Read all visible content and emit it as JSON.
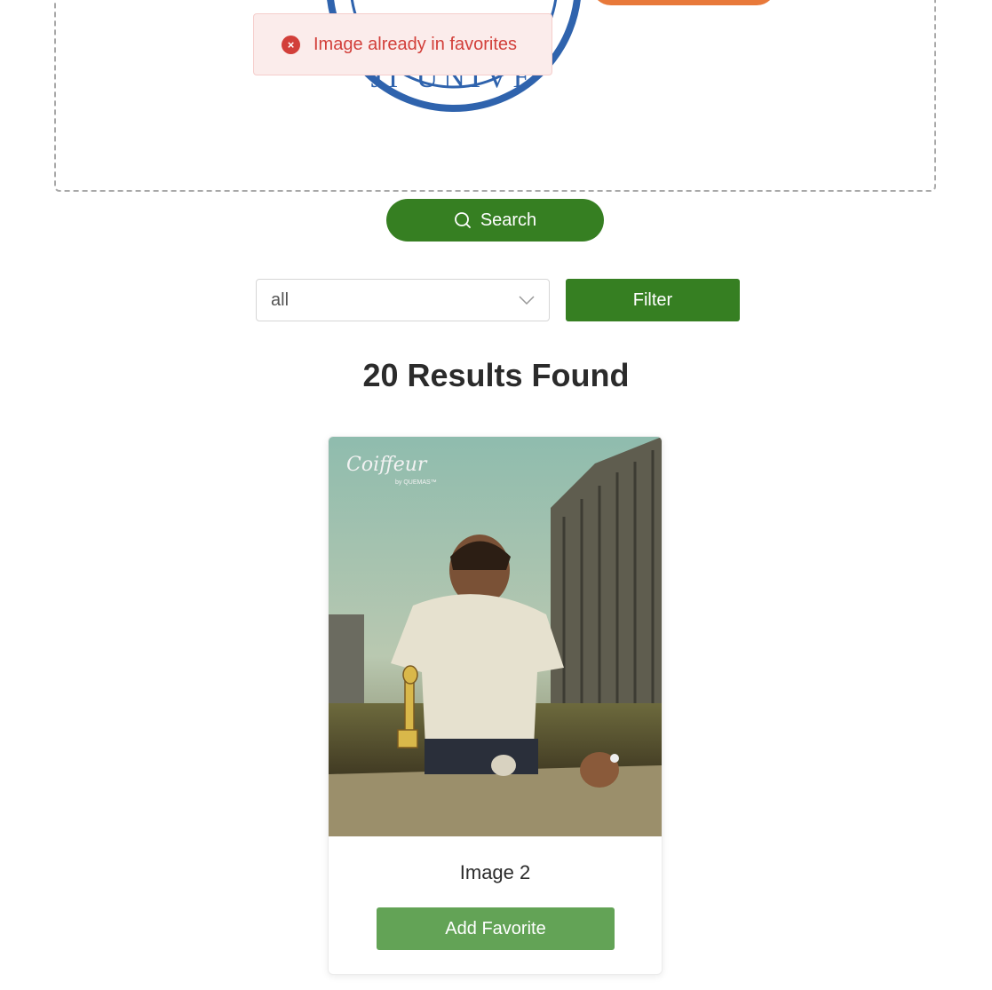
{
  "toast": {
    "message": "Image already in favorites",
    "icon": "error-circle-icon"
  },
  "search": {
    "button_label": "Search",
    "icon": "search-icon"
  },
  "filter": {
    "selected": "all",
    "button_label": "Filter"
  },
  "results": {
    "heading": "20 Results Found"
  },
  "card": {
    "title": "Image 2",
    "button_label": "Add Favorite",
    "image_caption": "Coiffeur",
    "image_subcaption": "by QUEMAS™"
  },
  "seal": {
    "text": "JI UNIVE"
  },
  "colors": {
    "primary_green": "#367f22",
    "favorite_green": "#63a356",
    "orange": "#e8793a",
    "error_red": "#d23f3a"
  }
}
